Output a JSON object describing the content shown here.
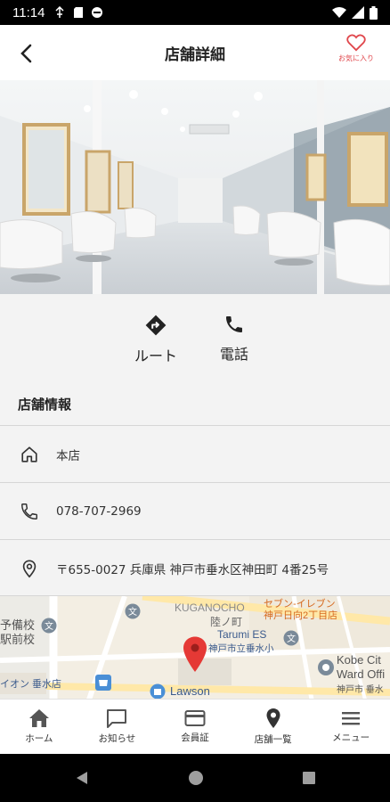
{
  "status_bar": {
    "time": "11:14"
  },
  "header": {
    "title": "店舗詳細",
    "favorite_label": "お気に入り"
  },
  "actions": {
    "route_label": "ルート",
    "phone_label": "電話"
  },
  "store_info": {
    "section_title": "店舗情報",
    "store_name": "本店",
    "phone": "078-707-2969",
    "address": "〒655-0027 兵庫県 神戸市垂水区神田町 4番25号"
  },
  "map": {
    "labels": {
      "kuganocho": "KUGANOCHO",
      "kuganocho_jp": "陸ノ町",
      "seven_eleven_1": "セブン-イレブン",
      "seven_eleven_2": "神戸日向2丁目店",
      "tarumi_es": "Tarumi ES",
      "tarumi_es_jp": "神戸市立垂水小",
      "lawson": "Lawson",
      "kobe_city": "Kobe Cit",
      "ward_office": "Ward Offi",
      "kobe_tarumi_jp": "神戸市 垂水",
      "school_left_1": "予備校",
      "school_left_2": "駅前校",
      "aeon": "イオン 垂水店"
    }
  },
  "bottom_nav": {
    "items": [
      {
        "label": "ホーム",
        "icon": "home-icon"
      },
      {
        "label": "お知らせ",
        "icon": "message-icon"
      },
      {
        "label": "会員証",
        "icon": "card-icon"
      },
      {
        "label": "店舗一覧",
        "icon": "location-pin-icon"
      },
      {
        "label": "メニュー",
        "icon": "hamburger-menu-icon"
      }
    ]
  },
  "colors": {
    "accent_red": "#e0474c",
    "map_pin": "#e53935"
  }
}
